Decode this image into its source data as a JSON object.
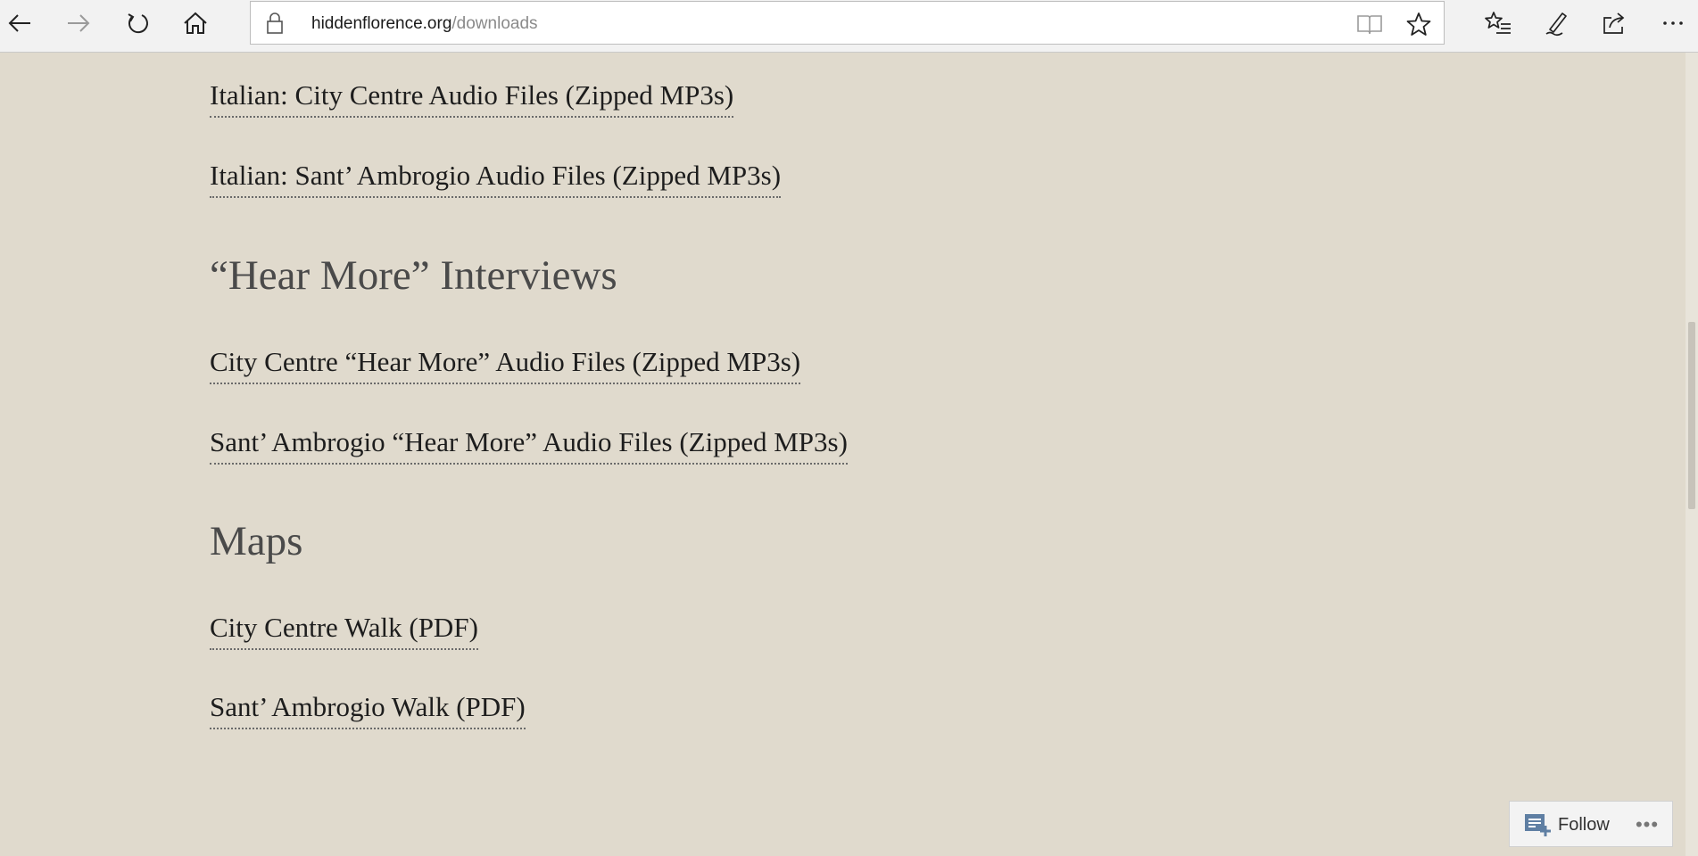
{
  "browser": {
    "url_domain": "hiddenflorence.org",
    "url_path": "/downloads",
    "icons": [
      "back-icon",
      "forward-icon",
      "refresh-icon",
      "home-icon",
      "lock-icon",
      "reading-view-icon",
      "favorite-star-icon",
      "favorites-hub-icon",
      "pen-notes-icon",
      "share-icon",
      "more-icon"
    ]
  },
  "content": {
    "links_top": [
      "Italian: City Centre Audio Files (Zipped MP3s)",
      "Italian: Sant’ Ambrogio Audio Files (Zipped MP3s)"
    ],
    "hear_more": {
      "heading": "“Hear More” Interviews",
      "links": [
        "City Centre “Hear More” Audio Files (Zipped MP3s)",
        "Sant’ Ambrogio “Hear More” Audio Files (Zipped MP3s)"
      ]
    },
    "maps": {
      "heading": "Maps",
      "links": [
        "City Centre Walk (PDF)",
        "Sant’ Ambrogio Walk (PDF)"
      ]
    }
  },
  "follow_widget": {
    "label": "Follow",
    "more_label": "•••"
  }
}
